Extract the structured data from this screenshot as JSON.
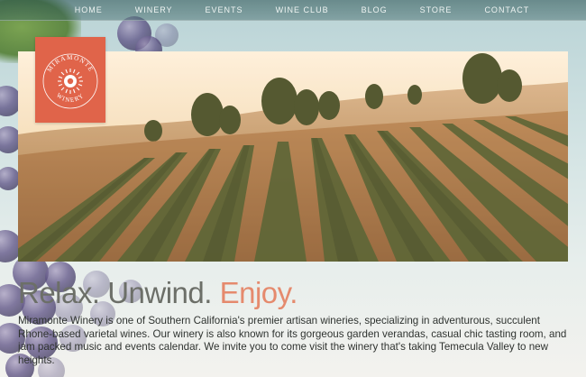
{
  "nav": {
    "items": [
      {
        "label": "HOME"
      },
      {
        "label": "WINERY"
      },
      {
        "label": "EVENTS"
      },
      {
        "label": "WINE CLUB"
      },
      {
        "label": "BLOG"
      },
      {
        "label": "STORE"
      },
      {
        "label": "CONTACT"
      }
    ]
  },
  "logo": {
    "top_text": "MIRAMONTE",
    "bottom_text": "WINERY",
    "color": "#e0644a"
  },
  "hero": {
    "image": "vineyard-rows-hillside"
  },
  "headline": {
    "part1": "Relax. Unwind. ",
    "part2": "Enjoy.",
    "accent_color": "#e58a6d"
  },
  "intro": {
    "text": "Miramonte Winery is one of Southern California's premier artisan wineries, specializing in adventurous, succulent Rhone-based varietal wines.  Our winery is also known for its gorgeous garden verandas, casual chic tasting room, and jam packed music and events calendar. We invite you to come visit the winery that's taking Temecula Valley to new heights."
  }
}
